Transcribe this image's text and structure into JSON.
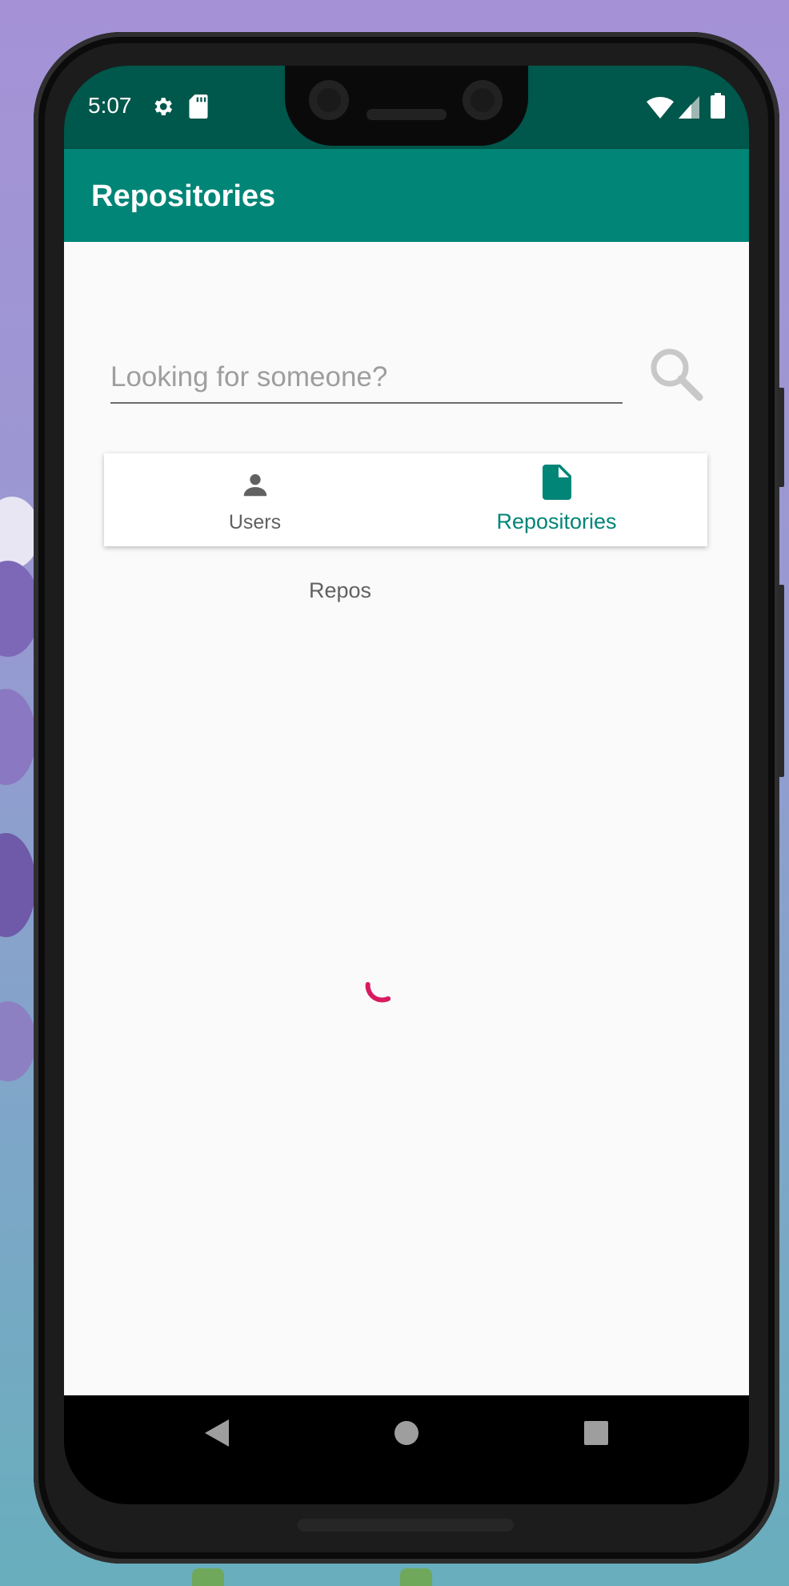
{
  "status_bar": {
    "time": "5:07",
    "icons": [
      "settings-icon",
      "sd-card-icon",
      "wifi-icon",
      "signal-icon",
      "battery-icon"
    ]
  },
  "app_bar": {
    "title": "Repositories"
  },
  "search": {
    "placeholder": "Looking for someone?",
    "value": ""
  },
  "tabs": [
    {
      "label": "Users",
      "icon": "person-icon",
      "selected": false
    },
    {
      "label": "Repositories",
      "icon": "file-icon",
      "selected": true
    }
  ],
  "content": {
    "section_label": "Repos",
    "loading": true
  },
  "nav_bar": {
    "buttons": [
      "back-icon",
      "home-icon",
      "recents-icon"
    ]
  },
  "colors": {
    "primary": "#008577",
    "primary_dark": "#00574b",
    "accent": "#d81b60",
    "tab_inactive": "#616161"
  }
}
